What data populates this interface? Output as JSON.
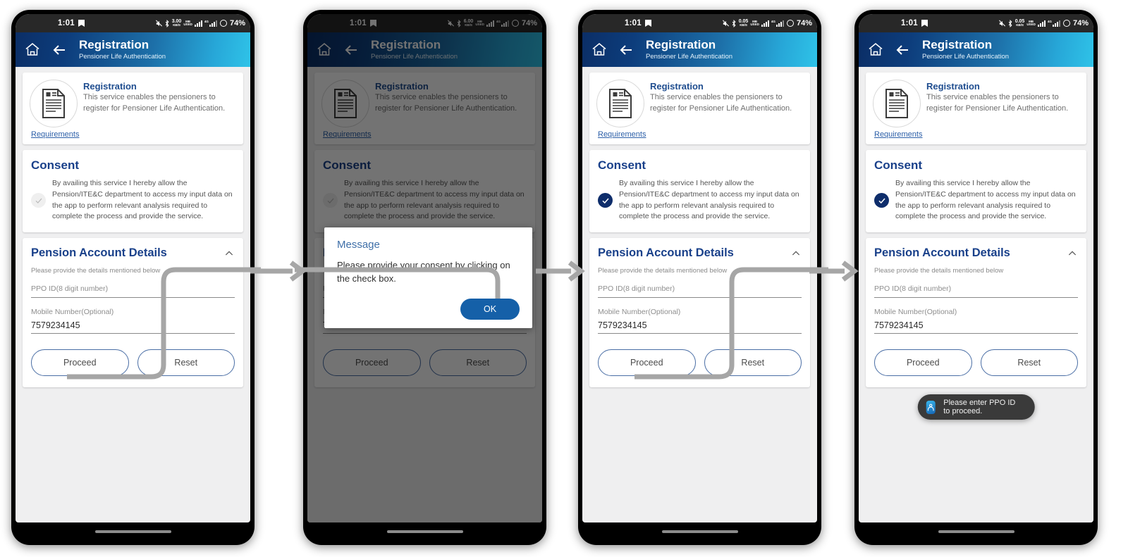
{
  "statusbar": {
    "time": "1:01",
    "battery": "74%",
    "network_label": "4G",
    "data_rates": [
      "3.00",
      "6.00",
      "0.05",
      "0.05"
    ],
    "data_unit": "KB/S",
    "icons": [
      "save-icon",
      "mute-icon",
      "bluetooth-icon",
      "data-rate-icon",
      "signal-bars-icon",
      "sim-signal-icon",
      "battery-ring-icon"
    ]
  },
  "header": {
    "title": "Registration",
    "subtitle": "Pensioner Life Authentication",
    "home_icon": "home-icon",
    "back_icon": "back-arrow-icon"
  },
  "service_card": {
    "icon": "document-person-icon",
    "title": "Registration",
    "description": "This service enables the pensioners to register for Pensioner Life Authentication.",
    "requirements_link": "Requirements"
  },
  "consent_card": {
    "title": "Consent",
    "text": "By availing this service I hereby allow the Pension/ITE&C department to access my input data on the app to perform relevant analysis required to complete the process and provide the service.",
    "checkbox_icon": "check-icon",
    "states": [
      "unchecked",
      "unchecked",
      "checked",
      "checked"
    ]
  },
  "pension_card": {
    "title": "Pension Account Details",
    "collapse_icon": "chevron-up-icon",
    "subtitle": "Please provide the details mentioned below",
    "fields": [
      {
        "label": "PPO ID(8 digit number)",
        "value": ""
      },
      {
        "label": "Mobile Number(Optional)",
        "value": "7579234145"
      }
    ],
    "buttons": {
      "proceed": "Proceed",
      "reset": "Reset"
    }
  },
  "dialog": {
    "title": "Message",
    "message": "Please provide your consent by clicking on the check box.",
    "ok_label": "OK"
  },
  "toast": {
    "message": "Please enter PPO ID to proceed.",
    "icon": "app-icon"
  },
  "colors": {
    "header_gradient_start": "#0b2e66",
    "header_gradient_end": "#2fc3e8",
    "heading_blue": "#19408a",
    "link_blue": "#2c5fa8",
    "checkbox_checked": "#0e2d6b",
    "dialog_button": "#1560a8",
    "toast_bg": "#3a3a3a",
    "connector_gray": "#a6a6a6"
  },
  "flow": {
    "panels": [
      "screen-1-initial",
      "screen-2-consent-dialog",
      "screen-3-consent-checked",
      "screen-4-ppo-toast"
    ],
    "arrow_icon": "flow-arrow-icon"
  }
}
